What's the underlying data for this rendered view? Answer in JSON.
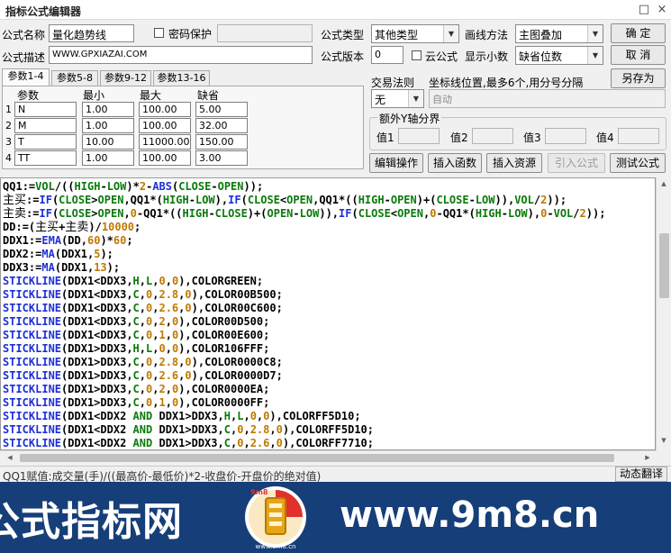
{
  "window": {
    "title": "指标公式编辑器",
    "btn_minimize": "□",
    "btn_close": "×"
  },
  "form": {
    "name_label": "公式名称",
    "name_value": "量化趋势线",
    "password_label": "密码保护",
    "type_label": "公式类型",
    "type_value": "其他类型",
    "draw_label": "画线方法",
    "draw_value": "主图叠加",
    "desc_label": "公式描述",
    "desc_value": "WWW.GPXIAZAI.COM",
    "version_label": "公式版本",
    "version_value": "0",
    "cloud_label": "云公式",
    "decimal_label": "显示小数",
    "decimal_value": "缺省位数",
    "ok_button": "确 定",
    "cancel_button": "取 消",
    "saveas_button": "另存为"
  },
  "tabs": [
    {
      "label": "参数1-4",
      "active": true
    },
    {
      "label": "参数5-8"
    },
    {
      "label": "参数9-12"
    },
    {
      "label": "参数13-16"
    }
  ],
  "params": {
    "headers": [
      "参数",
      "最小",
      "最大",
      "缺省"
    ],
    "rows": [
      {
        "num": "1",
        "name": "N",
        "min": "1.00",
        "max": "100.00",
        "def": "5.00"
      },
      {
        "num": "2",
        "name": "M",
        "min": "1.00",
        "max": "100.00",
        "def": "32.00"
      },
      {
        "num": "3",
        "name": "T",
        "min": "10.00",
        "max": "11000.00",
        "def": "150.00"
      },
      {
        "num": "4",
        "name": "TT",
        "min": "1.00",
        "max": "100.00",
        "def": "3.00"
      }
    ]
  },
  "trade": {
    "rule_label": "交易法则",
    "rule_value": "无",
    "coord_label": "坐标线位置,最多6个,用分号分隔",
    "coord_value": "自动",
    "yaxis_group": "额外Y轴分界",
    "val1": "值1",
    "val2": "值2",
    "val3": "值3",
    "val4": "值4"
  },
  "actions": {
    "edit": "编辑操作",
    "insert_func": "插入函数",
    "insert_res": "插入资源",
    "import": "引入公式",
    "test": "测试公式"
  },
  "code": [
    "QQ1:=VOL/((HIGH-LOW)*2-ABS(CLOSE-OPEN));",
    "主买:=IF(CLOSE>OPEN,QQ1*(HIGH-LOW),IF(CLOSE<OPEN,QQ1*((HIGH-OPEN)+(CLOSE-LOW)),VOL/2));",
    "主卖:=IF(CLOSE>OPEN,0-QQ1*((HIGH-CLOSE)+(OPEN-LOW)),IF(CLOSE<OPEN,0-QQ1*(HIGH-LOW),0-VOL/2));",
    "DD:=(主买+主卖)/10000;",
    "DDX1:=EMA(DD,60)*60;",
    "DDX2:=MA(DDX1,5);",
    "DDX3:=MA(DDX1,13);",
    "STICKLINE(DDX1<DDX3,H,L,0,0),COLORGREEN;",
    "STICKLINE(DDX1<DDX3,C,0,2.8,0),COLOR00B500;",
    "STICKLINE(DDX1<DDX3,C,0,2.6,0),COLOR00C600;",
    "STICKLINE(DDX1<DDX3,C,0,2,0),COLOR00D500;",
    "STICKLINE(DDX1<DDX3,C,0,1,0),COLOR00E600;",
    "STICKLINE(DDX1>DDX3,H,L,0,0),COLOR106FFF;",
    "STICKLINE(DDX1>DDX3,C,0,2.8,0),COLOR0000C8;",
    "STICKLINE(DDX1>DDX3,C,0,2.6,0),COLOR0000D7;",
    "STICKLINE(DDX1>DDX3,C,0,2,0),COLOR0000EA;",
    "STICKLINE(DDX1>DDX3,C,0,1,0),COLOR0000FF;",
    "STICKLINE(DDX1<DDX2 AND DDX1>DDX3,H,L,0,0),COLORFF5D10;",
    "STICKLINE(DDX1<DDX2 AND DDX1>DDX3,C,0,2.8,0),COLORFF5D10;",
    "STICKLINE(DDX1<DDX2 AND DDX1>DDX3,C,0,2.6,0),COLORFF7710;"
  ],
  "status": {
    "text": "QQ1赋值:成交量(手)/((最高价-最低价)*2-收盘价-开盘价的绝对值)",
    "translate": "动态翻译"
  },
  "banner": {
    "left_text": "公式指标网",
    "right_text": "www.9m8.cn",
    "logo_text": "9m8",
    "logo_sub": "www.9m8.cn"
  },
  "colors": {
    "keyword": "#0b7a0b",
    "function": "#1d2fd8",
    "number": "#c07800",
    "banner_bg": "#163e78"
  }
}
